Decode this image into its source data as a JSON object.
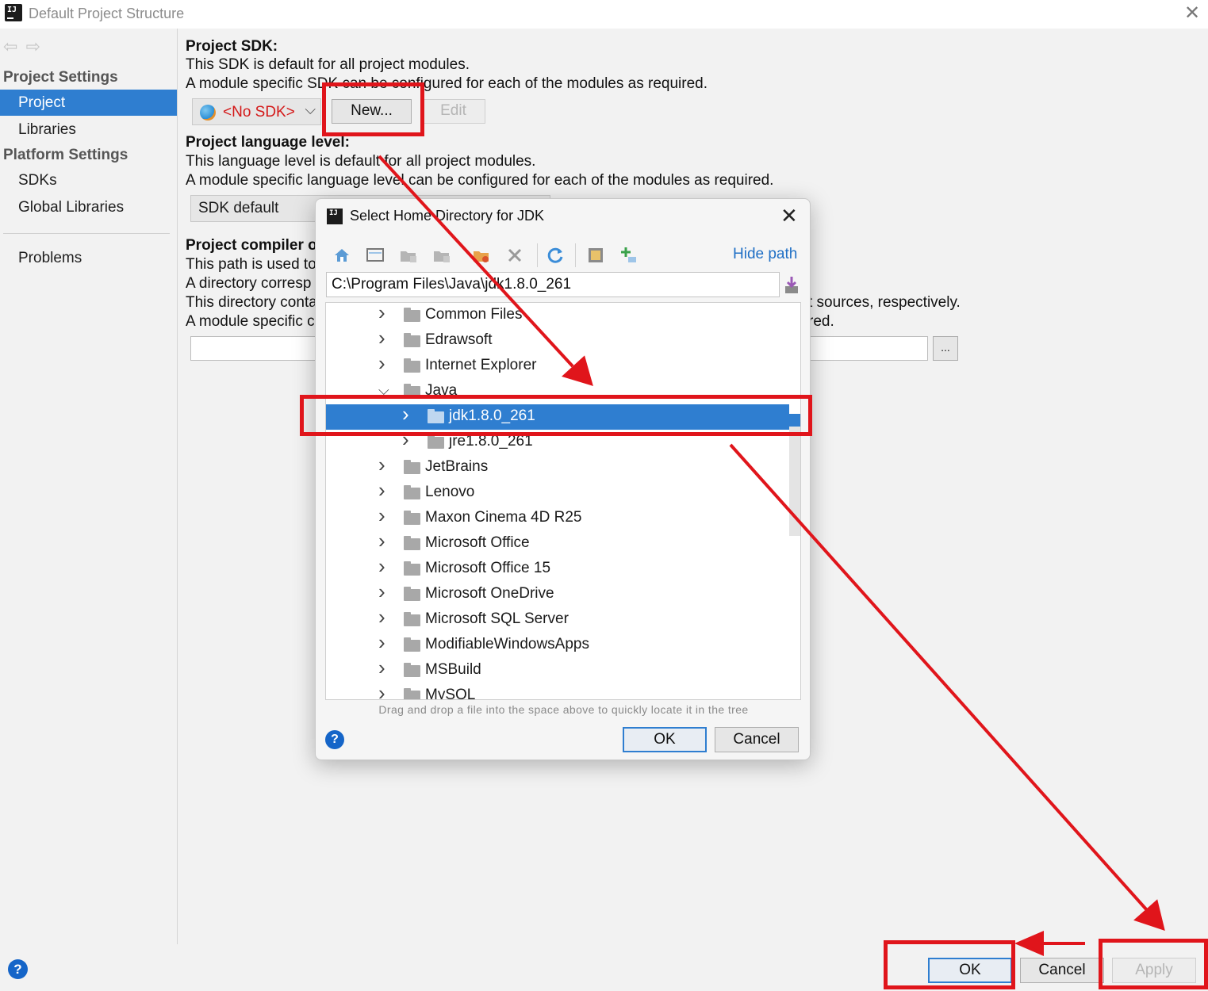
{
  "window": {
    "title": "Default Project Structure",
    "close_glyph": "✕"
  },
  "sidebar": {
    "section1": "Project Settings",
    "items1": [
      "Project",
      "Libraries"
    ],
    "section2": "Platform Settings",
    "items2": [
      "SDKs",
      "Global Libraries"
    ],
    "problems": "Problems",
    "selected": "Project"
  },
  "project_sdk": {
    "heading": "Project SDK:",
    "line1": "This SDK is default for all project modules.",
    "line2": "A module specific SDK can be configured for each of the modules as required.",
    "combo_value": "<No SDK>",
    "new_button": "New...",
    "edit_button": "Edit"
  },
  "language_level": {
    "heading": "Project language level:",
    "line1": "This language level is default for all project modules.",
    "line2": "A module specific language level can be configured for each of the modules as required.",
    "combo_value": "SDK default"
  },
  "compiler_output": {
    "heading": "Project compiler o",
    "line1": "This path is used to",
    "line2": "A directory corresp",
    "line3": "This directory conta",
    "line3_tail": "t sources, respectively.",
    "line4": "A module specific c",
    "line4_tail": "red.",
    "browse_button": "..."
  },
  "dialog": {
    "title": "Select Home Directory for JDK",
    "hide_path": "Hide path",
    "path_value": "C:\\Program Files\\Java\\jdk1.8.0_261",
    "tree": [
      {
        "label": "Common Files",
        "level": 0,
        "expanded": false
      },
      {
        "label": "Edrawsoft",
        "level": 0,
        "expanded": false
      },
      {
        "label": "Internet Explorer",
        "level": 0,
        "expanded": false
      },
      {
        "label": "Java",
        "level": 0,
        "expanded": true
      },
      {
        "label": "jdk1.8.0_261",
        "level": 1,
        "expanded": false,
        "selected": true
      },
      {
        "label": "jre1.8.0_261",
        "level": 1,
        "expanded": false
      },
      {
        "label": "JetBrains",
        "level": 0,
        "expanded": false
      },
      {
        "label": "Lenovo",
        "level": 0,
        "expanded": false
      },
      {
        "label": "Maxon Cinema 4D R25",
        "level": 0,
        "expanded": false
      },
      {
        "label": "Microsoft Office",
        "level": 0,
        "expanded": false
      },
      {
        "label": "Microsoft Office 15",
        "level": 0,
        "expanded": false
      },
      {
        "label": "Microsoft OneDrive",
        "level": 0,
        "expanded": false
      },
      {
        "label": "Microsoft SQL Server",
        "level": 0,
        "expanded": false
      },
      {
        "label": "ModifiableWindowsApps",
        "level": 0,
        "expanded": false
      },
      {
        "label": "MSBuild",
        "level": 0,
        "expanded": false
      },
      {
        "label": "MySQL",
        "level": 0,
        "expanded": false
      }
    ],
    "hint": "Drag and drop a file into the space above to quickly locate it in the tree",
    "ok": "OK",
    "cancel": "Cancel",
    "help": "?"
  },
  "footer": {
    "help": "?",
    "ok": "OK",
    "cancel": "Cancel",
    "apply": "Apply"
  },
  "colors": {
    "selection": "#2f7ed0",
    "annotation_red": "#e0151b",
    "no_sdk_text": "#d41919",
    "link": "#1f6fc5"
  }
}
